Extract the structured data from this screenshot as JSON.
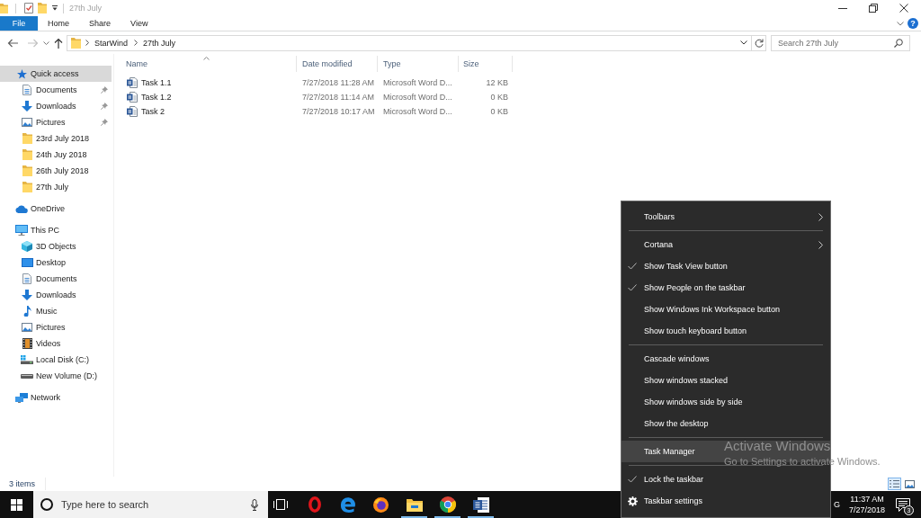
{
  "title_bar": {
    "title": "27th July"
  },
  "ribbon": {
    "tabs": [
      {
        "label": "File",
        "kind": "file"
      },
      {
        "label": "Home",
        "kind": "tab"
      },
      {
        "label": "Share",
        "kind": "tab"
      },
      {
        "label": "View",
        "kind": "tab"
      }
    ],
    "help": "?"
  },
  "address_bar": {
    "back": {
      "disabled": false
    },
    "forward": {
      "disabled": true
    },
    "path": [
      "StarWind",
      "27th July"
    ],
    "search": {
      "placeholder": "Search 27th July"
    }
  },
  "navigation_pane": {
    "items": [
      {
        "label": "Quick access",
        "kind": "quick_access",
        "selected": true,
        "children": [
          {
            "label": "Documents",
            "kind": "documents",
            "pinned": true,
            "selected": false
          },
          {
            "label": "Downloads",
            "kind": "downloads",
            "pinned": true,
            "selected": false
          },
          {
            "label": "Pictures",
            "kind": "pictures",
            "pinned": true,
            "selected": false
          },
          {
            "label": "23rd July 2018",
            "kind": "folder",
            "pinned": false,
            "selected": false
          },
          {
            "label": "24th Juy 2018",
            "kind": "folder",
            "pinned": false,
            "selected": false
          },
          {
            "label": "26th July 2018",
            "kind": "folder",
            "pinned": false,
            "selected": false
          },
          {
            "label": "27th July",
            "kind": "folder",
            "pinned": false,
            "selected": false
          }
        ]
      },
      {
        "label": "OneDrive",
        "kind": "onedrive",
        "selected": false
      },
      {
        "label": "This PC",
        "kind": "pc",
        "selected": false,
        "children": [
          {
            "label": "3D Objects",
            "kind": "objects_3d",
            "selected": false
          },
          {
            "label": "Desktop",
            "kind": "desktop",
            "selected": false
          },
          {
            "label": "Documents",
            "kind": "documents",
            "selected": false
          },
          {
            "label": "Downloads",
            "kind": "downloads",
            "selected": false
          },
          {
            "label": "Music",
            "kind": "music",
            "selected": false
          },
          {
            "label": "Pictures",
            "kind": "pictures",
            "selected": false
          },
          {
            "label": "Videos",
            "kind": "videos",
            "selected": false
          },
          {
            "label": "Local Disk (C:)",
            "kind": "system_drive",
            "selected": false
          },
          {
            "label": "New Volume (D:)",
            "kind": "drive",
            "selected": false
          }
        ]
      },
      {
        "label": "Network",
        "kind": "network",
        "selected": false
      }
    ]
  },
  "file_list": {
    "columns": [
      {
        "label": "Name",
        "sorted": true
      },
      {
        "label": "Date modified",
        "sorted": false
      },
      {
        "label": "Type",
        "sorted": false
      },
      {
        "label": "Size",
        "sorted": false
      }
    ],
    "rows": [
      {
        "name": "Task 1.1",
        "date_modified": "7/27/2018 11:28 AM",
        "type": "Microsoft Word D...",
        "size": "12 KB"
      },
      {
        "name": "Task 1.2",
        "date_modified": "7/27/2018 11:14 AM",
        "type": "Microsoft Word D...",
        "size": "0 KB"
      },
      {
        "name": "Task 2",
        "date_modified": "7/27/2018 10:17 AM",
        "type": "Microsoft Word D...",
        "size": "0 KB"
      }
    ]
  },
  "status_bar": {
    "item_count": "3 items",
    "views": [
      {
        "kind": "details",
        "selected": true
      },
      {
        "kind": "large_icons",
        "selected": false
      }
    ]
  },
  "taskbar": {
    "search": {
      "placeholder": "Type here to search"
    },
    "apps": [
      {
        "kind": "opera",
        "running": false
      },
      {
        "kind": "edge",
        "running": false
      },
      {
        "kind": "firefox",
        "running": false
      },
      {
        "kind": "file_explorer",
        "running": true
      },
      {
        "kind": "chrome",
        "running": true
      },
      {
        "kind": "word",
        "running": true
      }
    ],
    "tray": {
      "language": "G",
      "time": "11:37 AM",
      "date": "7/27/2018",
      "notifications": "3"
    }
  },
  "context_menu": {
    "groups": [
      [
        {
          "label": "Toolbars",
          "kind": "submenu",
          "selected": false
        }
      ],
      [
        {
          "label": "Cortana",
          "kind": "submenu",
          "selected": false
        },
        {
          "label": "Show Task View button",
          "kind": "toggle",
          "checked": true,
          "selected": false
        },
        {
          "label": "Show People on the taskbar",
          "kind": "toggle",
          "checked": true,
          "selected": false
        },
        {
          "label": "Show Windows Ink Workspace button",
          "kind": "toggle",
          "checked": false,
          "selected": false
        },
        {
          "label": "Show touch keyboard button",
          "kind": "toggle",
          "checked": false,
          "selected": false
        }
      ],
      [
        {
          "label": "Cascade windows",
          "kind": "action",
          "selected": false
        },
        {
          "label": "Show windows stacked",
          "kind": "action",
          "selected": false
        },
        {
          "label": "Show windows side by side",
          "kind": "action",
          "selected": false
        },
        {
          "label": "Show the desktop",
          "kind": "action",
          "selected": false
        }
      ],
      [
        {
          "label": "Task Manager",
          "kind": "action",
          "selected": true
        }
      ],
      [
        {
          "label": "Lock the taskbar",
          "kind": "toggle",
          "checked": true,
          "selected": false
        },
        {
          "label": "Taskbar settings",
          "kind": "settings",
          "selected": false
        }
      ]
    ]
  },
  "activation_notice": {
    "title": "Activate Windows",
    "message": "Go to Settings to activate Windows."
  }
}
